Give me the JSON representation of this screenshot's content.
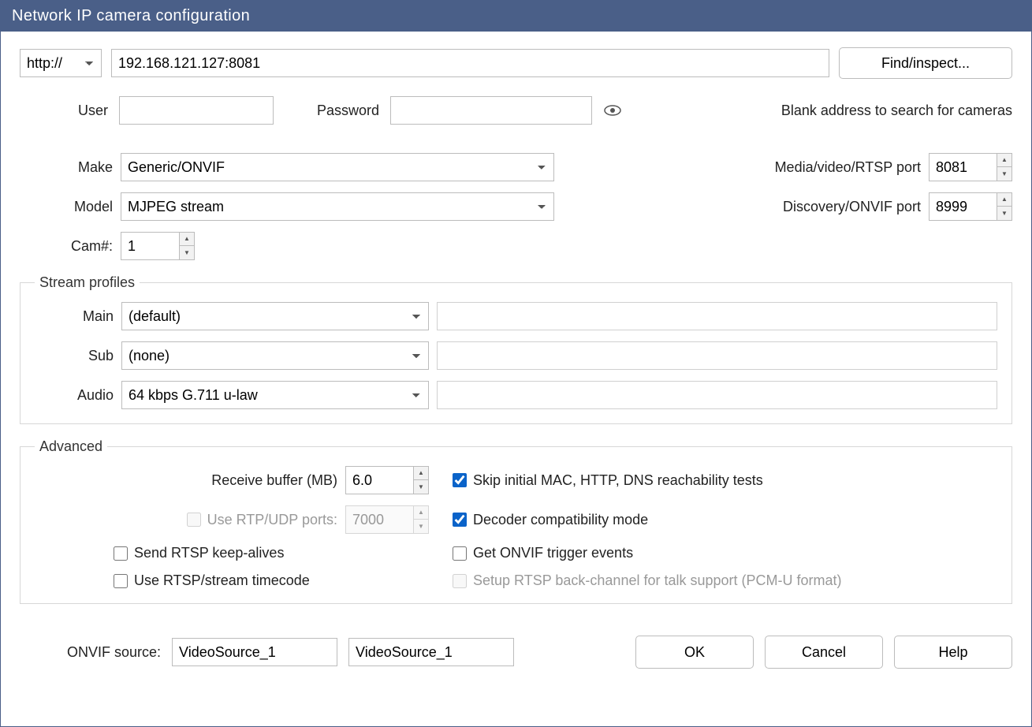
{
  "title": "Network IP camera configuration",
  "protocol": "http://",
  "address": "192.168.121.127:8081",
  "find_btn": "Find/inspect...",
  "user_label": "User",
  "user_value": "",
  "password_label": "Password",
  "password_value": "",
  "blank_hint": "Blank address to search for cameras",
  "make_label": "Make",
  "make_value": "Generic/ONVIF",
  "model_label": "Model",
  "model_value": "MJPEG stream",
  "cam_label": "Cam#:",
  "cam_value": "1",
  "rtsp_port_label": "Media/video/RTSP port",
  "rtsp_port_value": "8081",
  "onvif_port_label": "Discovery/ONVIF port",
  "onvif_port_value": "8999",
  "stream_legend": "Stream profiles",
  "main_label": "Main",
  "main_value": "(default)",
  "main_extra": "",
  "sub_label": "Sub",
  "sub_value": "(none)",
  "sub_extra": "",
  "audio_label": "Audio",
  "audio_value": "64 kbps G.711 u-law",
  "audio_extra": "",
  "adv_legend": "Advanced",
  "recv_label": "Receive buffer (MB)",
  "recv_value": "6.0",
  "rtp_label": "Use RTP/UDP ports:",
  "rtp_value": "7000",
  "keepalive_label": "Send RTSP keep-alives",
  "timecode_label": "Use RTSP/stream timecode",
  "skip_label": "Skip initial MAC, HTTP, DNS reachability tests",
  "decoder_label": "Decoder compatibility mode",
  "trigger_label": "Get ONVIF trigger events",
  "backchannel_label": "Setup RTSP back-channel for talk support (PCM-U format)",
  "onvif_src_label": "ONVIF source:",
  "onvif_src1": "VideoSource_1",
  "onvif_src2": "VideoSource_1",
  "ok": "OK",
  "cancel": "Cancel",
  "help": "Help"
}
